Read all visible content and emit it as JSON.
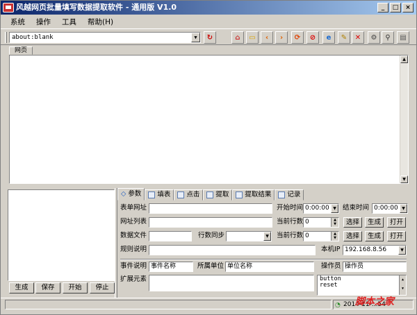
{
  "window": {
    "title": "风越网页批量填写数据提取软件 - 通用版 V1.0",
    "buttons": [
      "_",
      "□",
      "×"
    ]
  },
  "menu": [
    "系统",
    "操作",
    "工具",
    "帮助(H)"
  ],
  "toolbar": {
    "address": "about:blank"
  },
  "page_tab": "网页",
  "left_buttons": [
    "生成",
    "保存",
    "开始",
    "停止"
  ],
  "tabs": [
    "参数",
    "填表",
    "点击",
    "提取",
    "提取结果",
    "记录"
  ],
  "form": {
    "form_url_label": "表单网址",
    "start_time_label": "开始时间",
    "start_time": "0:00:00",
    "end_time_label": "结束时间",
    "end_time": "0:00:00",
    "url_list_label": "网址列表",
    "current_row_label": "当前行数",
    "current_row_1": "0",
    "current_row_2": "0",
    "data_file_label": "数据文件",
    "row_sync_label": "行数同步",
    "rule_desc_label": "规则说明",
    "local_ip_label": "本机IP",
    "local_ip": "192.168.8.56",
    "select_label": "选择",
    "generate_label": "生成",
    "open_label": "打开",
    "event_desc_label": "事件说明",
    "event_name": "事件名称",
    "unit_label": "所属单位",
    "unit_name": "单位名称",
    "operator_label": "操作员",
    "operator": "操作员",
    "extend_label": "扩展元素",
    "list_items": [
      "button",
      "reset"
    ]
  },
  "status": {
    "time": "2014-11-...54",
    "watermark": "脚本之家"
  }
}
